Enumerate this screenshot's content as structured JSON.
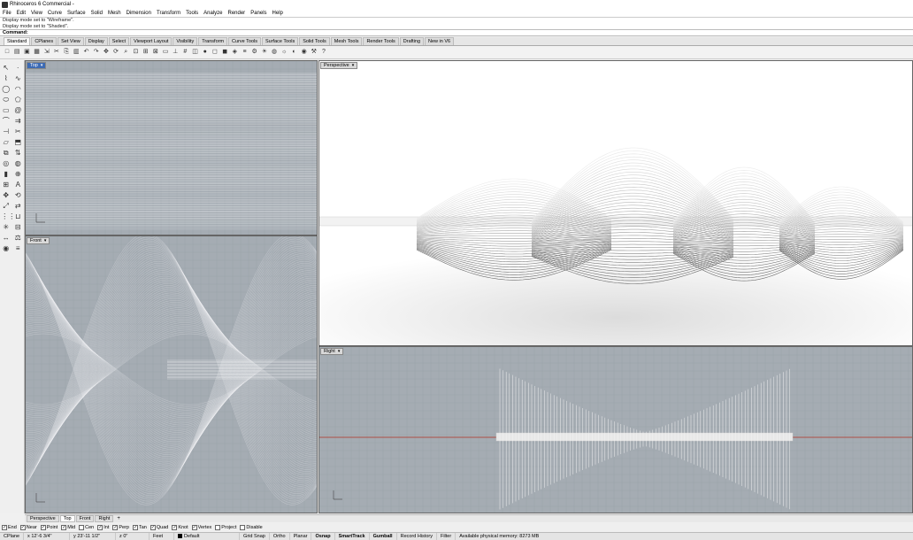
{
  "app": {
    "title": "Rhinoceros 6 Commercial -"
  },
  "menu": [
    "File",
    "Edit",
    "View",
    "Curve",
    "Surface",
    "Solid",
    "Mesh",
    "Dimension",
    "Transform",
    "Tools",
    "Analyze",
    "Render",
    "Panels",
    "Help"
  ],
  "command": {
    "history": [
      "Display mode set to \"Wireframe\".",
      "Display mode set to \"Shaded\"."
    ],
    "prompt": "Command:"
  },
  "tabs": [
    "Standard",
    "CPlanes",
    "Set View",
    "Display",
    "Select",
    "Viewport Layout",
    "Visibility",
    "Transform",
    "Curve Tools",
    "Surface Tools",
    "Solid Tools",
    "Mesh Tools",
    "Render Tools",
    "Drafting",
    "New in V6"
  ],
  "toolbar_icons": [
    "new-icon",
    "open-icon",
    "save-icon",
    "print-icon",
    "import-icon",
    "cut-icon",
    "copy-icon",
    "paste-icon",
    "undo-icon",
    "redo-icon",
    "pan-icon",
    "rotate-view-icon",
    "zoom-icon",
    "zoom-window-icon",
    "zoom-extents-icon",
    "zoom-selected-icon",
    "named-views-icon",
    "cplane-icon",
    "grid-icon",
    "set-view-icon",
    "sphere-icon",
    "wireframe-icon",
    "shaded-icon",
    "render-preview-icon",
    "layer-icon",
    "properties-icon",
    "lights-icon",
    "materials-icon",
    "sun-icon",
    "environment-icon",
    "render-icon",
    "options-icon",
    "help-icon"
  ],
  "viewports": {
    "top": {
      "label": "Top"
    },
    "perspective": {
      "label": "Perspective"
    },
    "front": {
      "label": "Front"
    },
    "right": {
      "label": "Right"
    }
  },
  "viewport_tabs": [
    "Perspective",
    "Top",
    "Front",
    "Right"
  ],
  "osnaps": [
    {
      "label": "End",
      "checked": true
    },
    {
      "label": "Near",
      "checked": true
    },
    {
      "label": "Point",
      "checked": true
    },
    {
      "label": "Mid",
      "checked": true
    },
    {
      "label": "Cen",
      "checked": false
    },
    {
      "label": "Int",
      "checked": true
    },
    {
      "label": "Perp",
      "checked": true
    },
    {
      "label": "Tan",
      "checked": true
    },
    {
      "label": "Quad",
      "checked": true
    },
    {
      "label": "Knot",
      "checked": true
    },
    {
      "label": "Vertex",
      "checked": true
    },
    {
      "label": "Project",
      "checked": false
    },
    {
      "label": "Disable",
      "checked": false
    }
  ],
  "status": {
    "cplane": "CPlane",
    "x": "x 12'-6 3/4\"",
    "y": "y 23'-11 1/2\"",
    "z": "z 0\"",
    "units": "Feet",
    "layer": "Default",
    "grid_snap": "Grid Snap",
    "ortho": "Ortho",
    "planar": "Planar",
    "osnap": "Osnap",
    "smarttrack": "SmartTrack",
    "gumball": "Gumball",
    "record_history": "Record History",
    "filter": "Filter",
    "memory": "Available physical memory: 8273 MB"
  },
  "colors": {
    "active_tab": "#3c6ab4",
    "viewport_bg": "#a5acb3",
    "perspective_bg": "#ffffff",
    "axis_red": "#b03020"
  }
}
